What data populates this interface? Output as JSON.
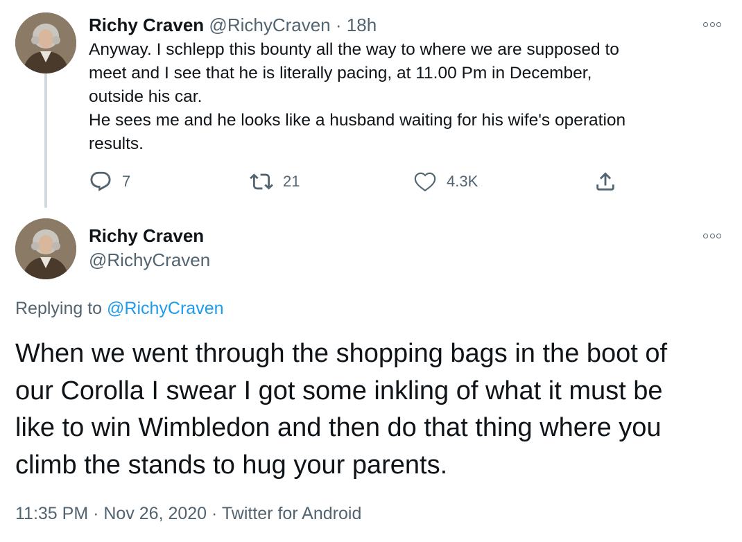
{
  "first_tweet": {
    "name": "Richy Craven",
    "handle": "@RichyCraven",
    "separator": "·",
    "time": "18h",
    "lines": [
      "Anyway. I schlepp this bounty all the way to where we are supposed to",
      "meet and I see that he is literally pacing, at 11.00 Pm in December,",
      "outside his car.",
      "He sees me and he looks like a husband waiting for his wife's operation",
      "results."
    ],
    "actions": {
      "reply_icon": "reply-icon",
      "reply_count": "7",
      "retweet_icon": "retweet-icon",
      "retweet_count": "21",
      "like_icon": "heart-icon",
      "like_count": "4.3K",
      "share_icon": "share-icon"
    },
    "more_icon": "more-options-icon"
  },
  "second_tweet": {
    "name": "Richy Craven",
    "handle": "@RichyCraven",
    "replying_prefix": "Replying to",
    "replying_handle": "@RichyCraven",
    "lines": [
      "When we went through the shopping bags in the boot of",
      "our Corolla I swear I got some inkling of what it must be",
      "like to win Wimbledon and then do that thing where you",
      "climb the stands to hug your parents."
    ],
    "timestamp": "11:35 PM · Nov 26, 2020",
    "meta_separator": "·",
    "source": "Twitter for Android",
    "more_icon": "more-options-icon"
  },
  "colors": {
    "text_primary": "#0f1419",
    "text_secondary": "#536471",
    "link": "#1d9bf0",
    "thread_line": "#cfd9de"
  }
}
